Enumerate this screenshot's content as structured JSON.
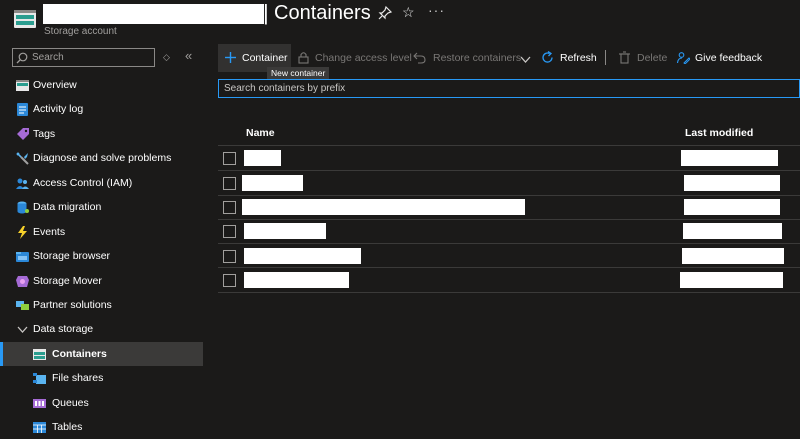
{
  "header": {
    "title": "Containers",
    "separator": "|",
    "subtitle": "Storage account",
    "icons": [
      "storage-account-icon",
      "pin-icon",
      "star-icon",
      "more-icon"
    ],
    "more": "···",
    "star": "☆"
  },
  "sidebar": {
    "search_placeholder": "Search",
    "sort_glyph": "◇",
    "collapse_glyph": "«",
    "items": [
      {
        "label": "Overview",
        "icon": "overview-icon"
      },
      {
        "label": "Activity log",
        "icon": "activity-log-icon"
      },
      {
        "label": "Tags",
        "icon": "tag-icon"
      },
      {
        "label": "Diagnose and solve problems",
        "icon": "wrench-icon"
      },
      {
        "label": "Access Control (IAM)",
        "icon": "people-icon"
      },
      {
        "label": "Data migration",
        "icon": "database-icon"
      },
      {
        "label": "Events",
        "icon": "lightning-icon"
      },
      {
        "label": "Storage browser",
        "icon": "storage-browser-icon"
      },
      {
        "label": "Storage Mover",
        "icon": "storage-mover-icon"
      },
      {
        "label": "Partner solutions",
        "icon": "partner-icon"
      },
      {
        "label": "Data storage",
        "icon": "chevron-down-icon"
      },
      {
        "label": "Containers",
        "icon": "containers-icon",
        "active": true
      },
      {
        "label": "File shares",
        "icon": "file-shares-icon"
      },
      {
        "label": "Queues",
        "icon": "queues-icon"
      },
      {
        "label": "Tables",
        "icon": "tables-icon"
      }
    ]
  },
  "toolbar": {
    "container": "Container",
    "change_access": "Change access level",
    "restore": "Restore containers",
    "refresh": "Refresh",
    "delete": "Delete",
    "feedback": "Give feedback",
    "tooltip": "New container"
  },
  "filter": {
    "placeholder": "Search containers by prefix"
  },
  "table": {
    "columns": [
      "Name",
      "Last modified"
    ],
    "row_count": 6
  },
  "colors": {
    "accent": "#2899f5",
    "background": "#1b1a19",
    "disabled": "#797775"
  }
}
